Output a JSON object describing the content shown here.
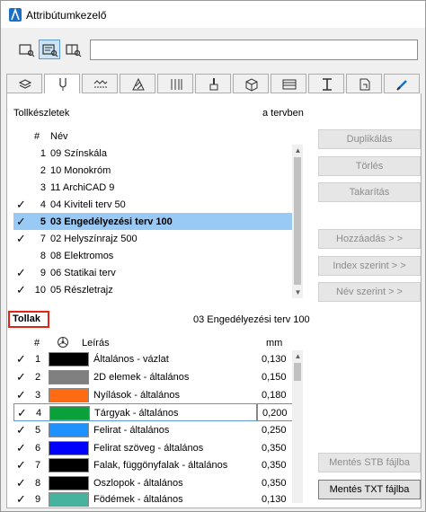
{
  "window": {
    "title": "Attribútumkezelő"
  },
  "search": {
    "value": ""
  },
  "penSets": {
    "title": "Tollkészletek",
    "status": "a tervben",
    "columns": {
      "number": "#",
      "name": "Név"
    },
    "rows": [
      {
        "check": "",
        "number": "1",
        "name": "09 Színskála"
      },
      {
        "check": "",
        "number": "2",
        "name": "10 Monokróm"
      },
      {
        "check": "",
        "number": "3",
        "name": "11 ArchiCAD 9"
      },
      {
        "check": "✓",
        "number": "4",
        "name": "04 Kiviteli terv 50"
      },
      {
        "check": "✓",
        "number": "5",
        "name": "03 Engedélyezési terv 100"
      },
      {
        "check": "✓",
        "number": "7",
        "name": "02 Helyszínrajz 500"
      },
      {
        "check": "",
        "number": "8",
        "name": "08 Elektromos"
      },
      {
        "check": "✓",
        "number": "9",
        "name": "06 Statikai terv"
      },
      {
        "check": "✓",
        "number": "10",
        "name": "05 Részletrajz"
      }
    ]
  },
  "buttons": {
    "duplicate": "Duplikálás",
    "delete": "Törlés",
    "purge": "Takarítás",
    "add": "Hozzáadás > >",
    "byIndex": "Index szerint > >",
    "byName": "Név szerint > >",
    "saveStb": "Mentés STB fájlba",
    "saveTxt": "Mentés TXT fájlba"
  },
  "pens": {
    "title": "Tollak",
    "selectedSet": "03 Engedélyezési terv 100",
    "columns": {
      "number": "#",
      "description": "Leírás",
      "mm": "mm"
    },
    "rows": [
      {
        "check": "✓",
        "number": "1",
        "color": "#000000",
        "description": "Általános - vázlat",
        "mm": "0,130"
      },
      {
        "check": "✓",
        "number": "2",
        "color": "#808080",
        "description": "2D elemek - általános",
        "mm": "0,150"
      },
      {
        "check": "✓",
        "number": "3",
        "color": "#ff6a13",
        "description": "Nyílások - általános",
        "mm": "0,180"
      },
      {
        "check": "✓",
        "number": "4",
        "color": "#0aa13a",
        "description": "Tárgyak - általános",
        "mm": "0,200"
      },
      {
        "check": "✓",
        "number": "5",
        "color": "#1e90ff",
        "description": "Felirat - általános",
        "mm": "0,250"
      },
      {
        "check": "✓",
        "number": "6",
        "color": "#0000ff",
        "description": "Felirat szöveg - általános",
        "mm": "0,350"
      },
      {
        "check": "✓",
        "number": "7",
        "color": "#000000",
        "description": "Falak, függönyfalak - általános",
        "mm": "0,350"
      },
      {
        "check": "✓",
        "number": "8",
        "color": "#000000",
        "description": "Oszlopok - általános",
        "mm": "0,350"
      },
      {
        "check": "✓",
        "number": "9",
        "color": "#45b39d",
        "description": "Födémek - általános",
        "mm": "0,130"
      }
    ]
  }
}
